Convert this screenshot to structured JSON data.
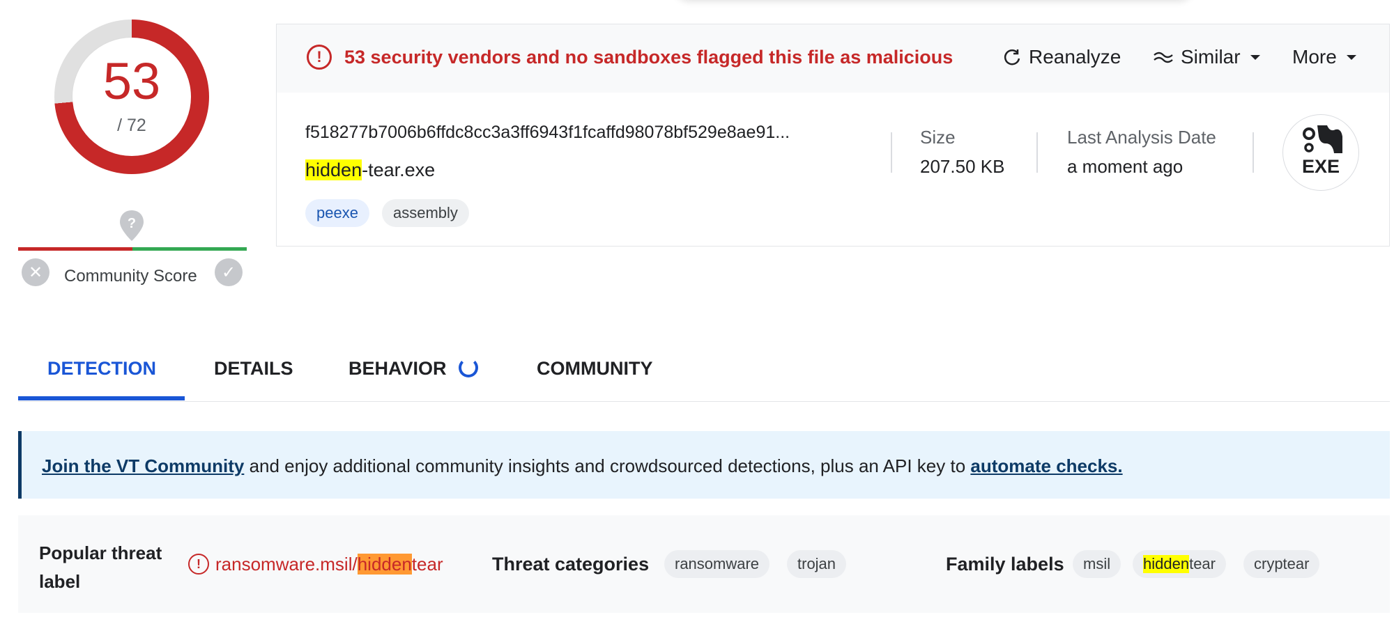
{
  "score": {
    "detections": "53",
    "total": "/ 72",
    "community_label": "Community Score"
  },
  "alert": {
    "message": "53 security vendors and no sandboxes flagged this file as malicious"
  },
  "actions": {
    "reanalyze": "Reanalyze",
    "similar": "Similar",
    "more": "More"
  },
  "file": {
    "hash": "f518277b7006b6ffdc8cc3a3ff6943f1fcaffd98078bf529e8ae91...",
    "name_highlight": "hidden",
    "name_rest": "-tear.exe",
    "tags": [
      "peexe",
      "assembly"
    ],
    "size_label": "Size",
    "size_value": "207.50 KB",
    "date_label": "Last Analysis Date",
    "date_value": "a moment ago",
    "type_badge": "EXE"
  },
  "tabs": {
    "detection": "DETECTION",
    "details": "DETAILS",
    "behavior": "BEHAVIOR",
    "community": "COMMUNITY"
  },
  "banner": {
    "link1": "Join the VT Community",
    "text": " and enjoy additional community insights and crowdsourced detections, plus an API key to ",
    "link2": "automate checks."
  },
  "threat": {
    "popular_label": "Popular threat label",
    "popular_prefix": "ransomware.msil/",
    "popular_highlight": "hidden",
    "popular_suffix": "tear",
    "categories_label": "Threat categories",
    "categories": [
      "ransomware",
      "trojan"
    ],
    "family_label": "Family labels",
    "family_1": "msil",
    "family_2_highlight": "hidden",
    "family_2_rest": "tear",
    "family_3": "cryptear"
  },
  "colors": {
    "malicious_red": "#c62828",
    "accent_blue": "#1a56d6",
    "highlight_yellow": "#ffff00",
    "highlight_orange": "#ff9933"
  }
}
